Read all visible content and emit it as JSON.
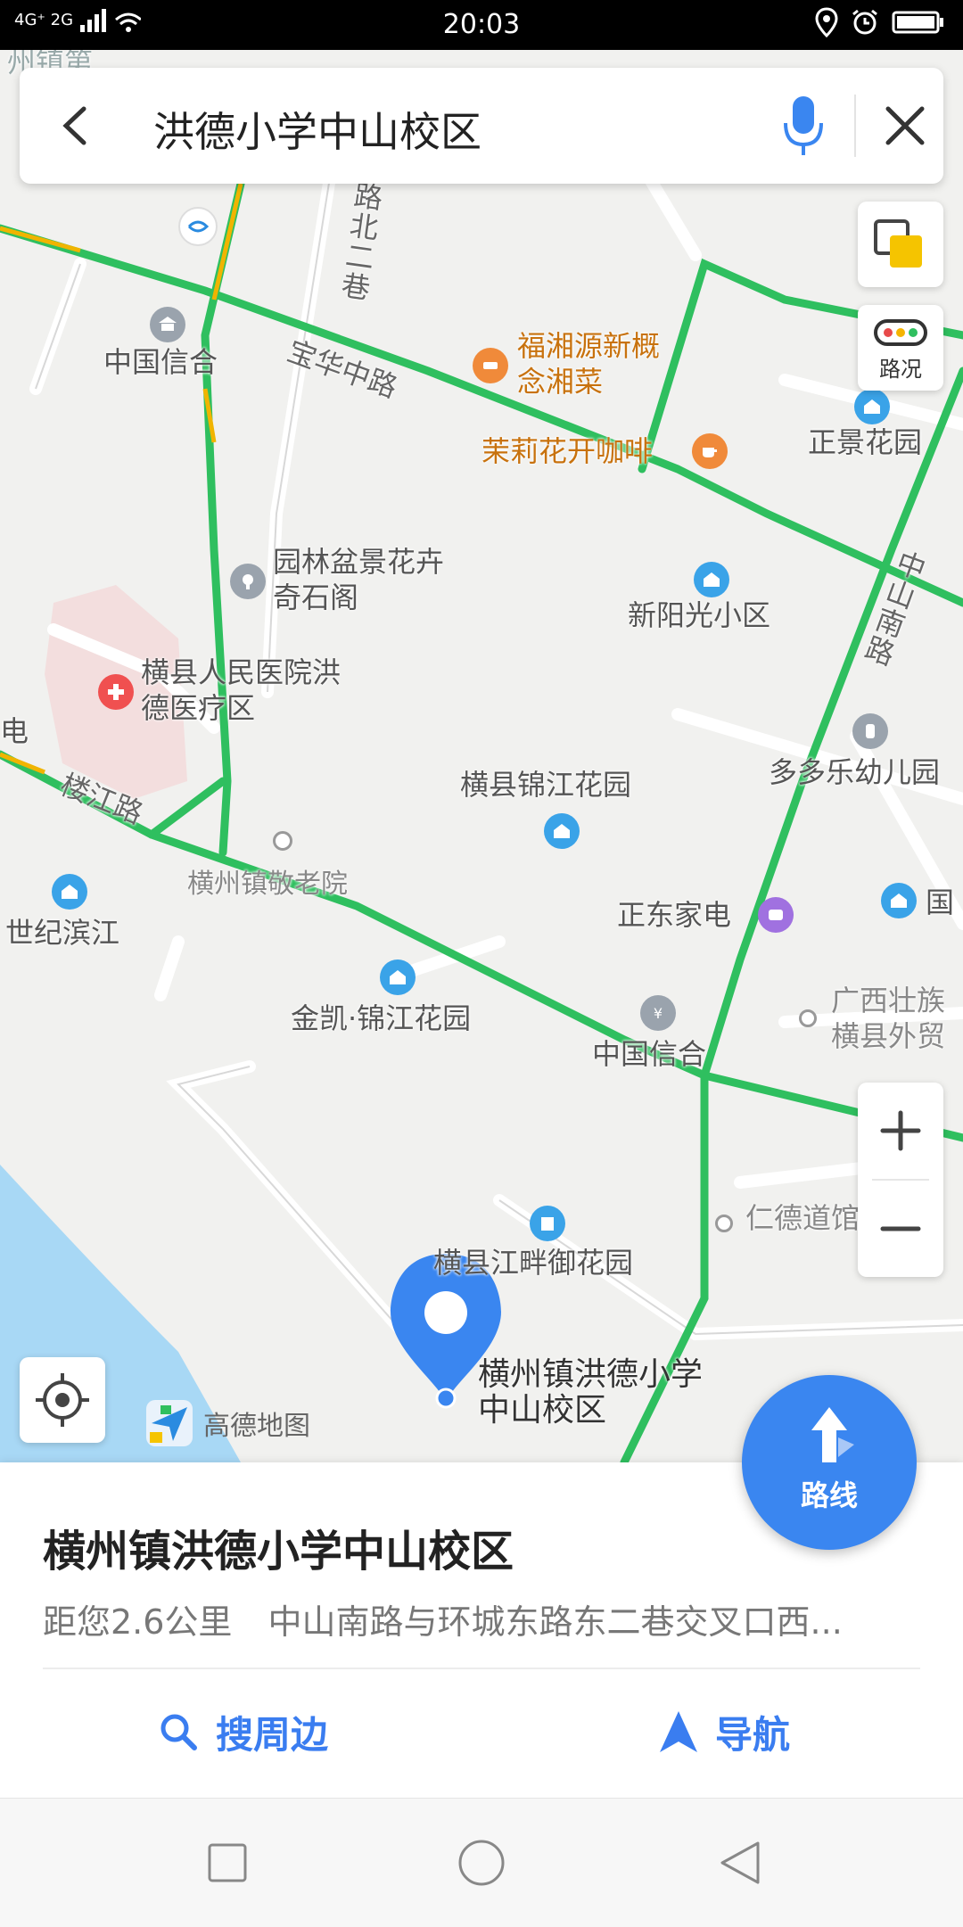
{
  "status_bar": {
    "network_left": "4G⁺ 2G",
    "time": "20:03"
  },
  "search": {
    "query": "洪德小学中山校区"
  },
  "traffic": {
    "label": "路况"
  },
  "map": {
    "labels": {
      "road_north_lane": "路北二巷",
      "road_baohua": "宝华中路",
      "road_louzhang": "楼江路",
      "road_zhongshan": "中山南路",
      "china_xinhe_top": "中国信合",
      "restaurant": "福湘源新概念湘菜",
      "cafe": "茉莉花开咖啡",
      "zhengjing": "正景花园",
      "garden_stone": "园林盆景花卉奇石阁",
      "xinyangguang": "新阳光小区",
      "hospital": "横县人民医院洪德医疗区",
      "jinjiang_garden": "横县锦江花园",
      "duoduole": "多多乐幼儿园",
      "elderly_home": "横州镇敬老院",
      "shiji_binjiang": "世纪滨江",
      "zhengdong": "正东家电",
      "guo_partial": "国",
      "jinkai": "金凯·锦江花园",
      "china_xinhe_bottom": "中国信合",
      "guangxi_trade": "广西壮族横县外贸",
      "rende": "仁德道馆",
      "riverside": "横县江畔御花园",
      "selected_place": "横州镇洪德小学中山校区",
      "top_left_partial": "州镇第",
      "left_partial": "电"
    },
    "logo": "高德地图"
  },
  "route": {
    "label": "路线"
  },
  "place_card": {
    "title": "横州镇洪德小学中山校区",
    "distance": "距您2.6公里",
    "address": "中山南路与环城东路东二巷交叉口西...",
    "search_nearby": "搜周边",
    "navigate": "导航"
  },
  "colors": {
    "road_green": "#2fbf5f",
    "road_yellow": "#f0b400",
    "water": "#a8d8f5",
    "accent_blue": "#3a86f0",
    "hospital_red": "#f05050"
  }
}
